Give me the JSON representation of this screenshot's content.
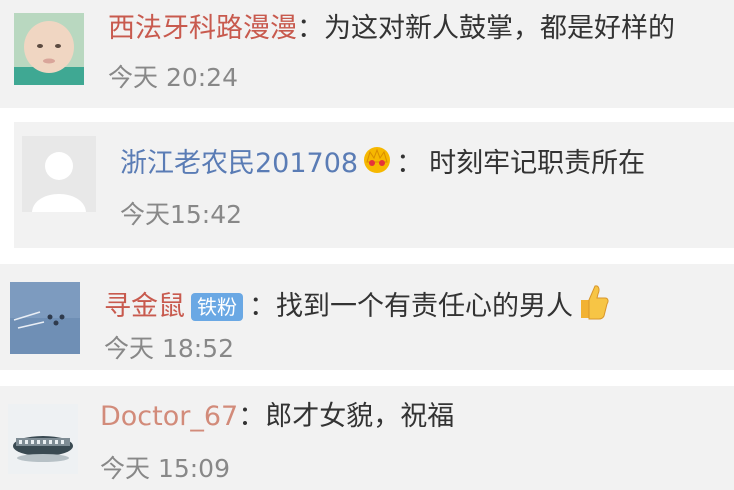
{
  "comments": [
    {
      "username": "西法牙科路漫漫",
      "sep": "：",
      "text": "为这对新人鼓掌，都是好样的",
      "time": "今天 20:24"
    },
    {
      "username": "浙江老农民201708",
      "badge_icon": "crown-icon",
      "sep": "：",
      "text": "时刻牢记职责所在",
      "time": "今天15:42"
    },
    {
      "username": "寻金鼠",
      "badge": "铁粉",
      "sep": "：",
      "text": "找到一个有责任心的男人",
      "emoji_icon": "thumbs-up-icon",
      "time": "今天 18:52"
    },
    {
      "username": "Doctor_67",
      "sep": "：",
      "text": "郎才女貌，祝福",
      "time": "今天 15:09"
    }
  ],
  "colors": {
    "card_bg": "#f2f2f2",
    "username_red": "#c85a4e",
    "username_blue": "#5a7cb5",
    "badge_blue": "#6aa8e4",
    "time_gray": "#888888"
  }
}
